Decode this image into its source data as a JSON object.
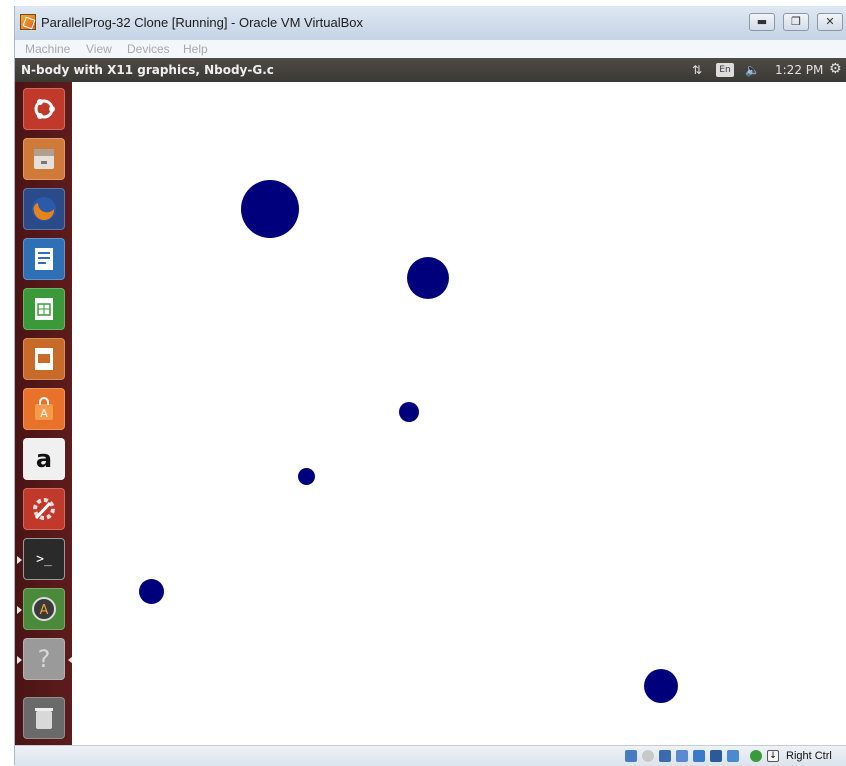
{
  "window": {
    "title": "ParallelProg-32 Clone [Running] - Oracle VM VirtualBox",
    "minimize_icon": "minimize-icon",
    "restore_icon": "restore-icon",
    "close_icon": "close-icon"
  },
  "menubar": {
    "items": [
      "Machine",
      "View",
      "Devices",
      "Help"
    ]
  },
  "topbar": {
    "app_title": "N-body with X11 graphics, Nbody-G.c",
    "keyboard_layout": "En",
    "time": "1:22 PM",
    "network_icon": "network-arrows-icon",
    "volume_icon": "volume-icon",
    "settings_icon": "gear-icon"
  },
  "launcher": {
    "items": [
      {
        "name": "ubuntu-dash",
        "icon": "ubuntu-logo-icon",
        "color": "#c0392b"
      },
      {
        "name": "files",
        "icon": "file-cabinet-icon",
        "color": "#d07a3a"
      },
      {
        "name": "firefox",
        "icon": "firefox-icon",
        "color": "#e06a1a"
      },
      {
        "name": "writer",
        "icon": "document-icon",
        "color": "#2f6fb5"
      },
      {
        "name": "calc",
        "icon": "spreadsheet-icon",
        "color": "#3a9a3a"
      },
      {
        "name": "impress",
        "icon": "presentation-icon",
        "color": "#c86a2a"
      },
      {
        "name": "software-center",
        "icon": "shopping-bag-icon",
        "color": "#e8722a"
      },
      {
        "name": "amazon",
        "icon": "amazon-icon",
        "color": "#f0f0f0"
      },
      {
        "name": "system-settings",
        "icon": "wrench-gear-icon",
        "color": "#c0392b"
      },
      {
        "name": "terminal",
        "icon": "terminal-icon",
        "color": "#2a2a2a"
      },
      {
        "name": "software-updater",
        "icon": "updater-icon",
        "color": "#4a8a3a"
      },
      {
        "name": "help",
        "icon": "question-icon",
        "color": "#9a9a9a"
      },
      {
        "name": "trash",
        "icon": "trash-icon",
        "color": "#8a8a8a"
      }
    ],
    "amazon_glyph": "a",
    "help_glyph": "?",
    "terminal_glyph": ">_"
  },
  "simulation": {
    "body_color": "#00007d",
    "bodies": [
      {
        "name": "body-1",
        "size": "large"
      },
      {
        "name": "body-2",
        "size": "medium"
      },
      {
        "name": "body-3",
        "size": "small"
      },
      {
        "name": "body-4",
        "size": "small"
      },
      {
        "name": "body-5",
        "size": "small"
      },
      {
        "name": "body-6",
        "size": "medium"
      }
    ]
  },
  "statusbar": {
    "icons": [
      "hard-disk-icon",
      "optical-drive-icon",
      "usb-icon",
      "shared-folders-icon",
      "display-icon",
      "network-adapter-icon",
      "video-capture-icon",
      "cpu-icon",
      "mouse-integration-icon"
    ],
    "host_key": "Right Ctrl"
  }
}
